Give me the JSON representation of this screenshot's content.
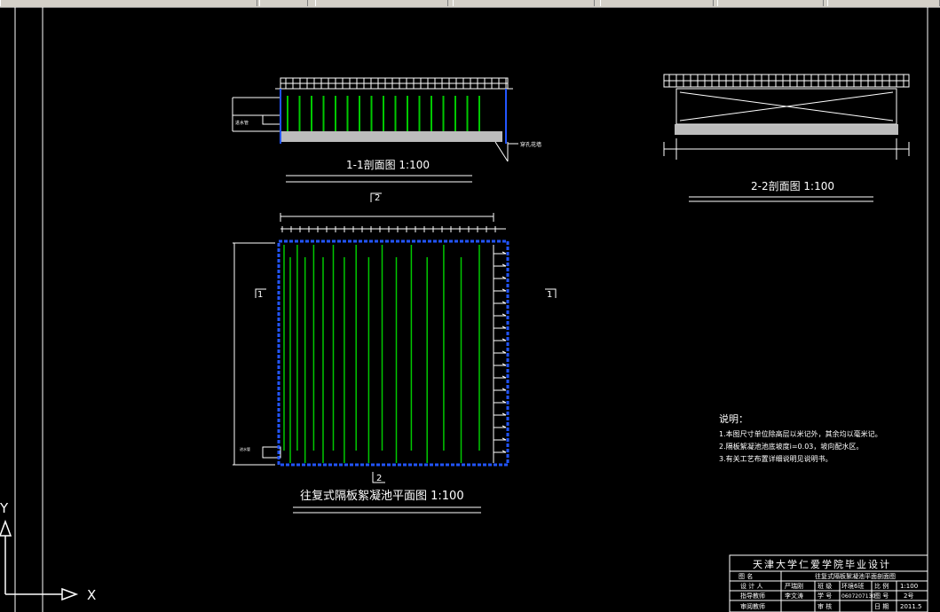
{
  "toolbar": {
    "segments": [
      "",
      "",
      "",
      "",
      "",
      ""
    ]
  },
  "drawing": {
    "section11": {
      "title": "1-1剖面图   1:100",
      "pipe_label": "穿孔花墙"
    },
    "section22": {
      "title": "2-2剖面图   1:100"
    },
    "plan": {
      "title": "往复式隔板絮凝池平面图   1:100"
    },
    "section_markers": {
      "mark1": "1",
      "mark2": "2"
    },
    "notes": {
      "heading": "说明：",
      "lines": [
        "1.本图尺寸单位除高层以米记外，其余均以毫米记。",
        "2.隔板絮凝池池底坡度i=0.03，坡向配水区。",
        "3.有关工艺布置详细说明见说明书。"
      ]
    },
    "title_block": {
      "header": "天津大学仁爱学院毕业设计",
      "rows": [
        [
          "图   名",
          "往复式隔板絮凝池平面剖面图",
          "",
          "",
          "",
          ""
        ],
        [
          "设 计 人",
          "严瑞刚",
          "班 级",
          "环境6班",
          "比 例",
          "1:100"
        ],
        [
          "指导教师",
          "李文涛",
          "学 号",
          "0607207130",
          "图 号",
          "2号"
        ],
        [
          "审阅教师",
          "",
          "审 核",
          "",
          "日 期",
          "2011.5"
        ]
      ]
    },
    "ucs": {
      "x_label": "X",
      "y_label": "Y"
    }
  },
  "colors": {
    "background": "#000000",
    "line": "#ffffff",
    "baffle": "#00c800",
    "wall": "#0000ff"
  }
}
